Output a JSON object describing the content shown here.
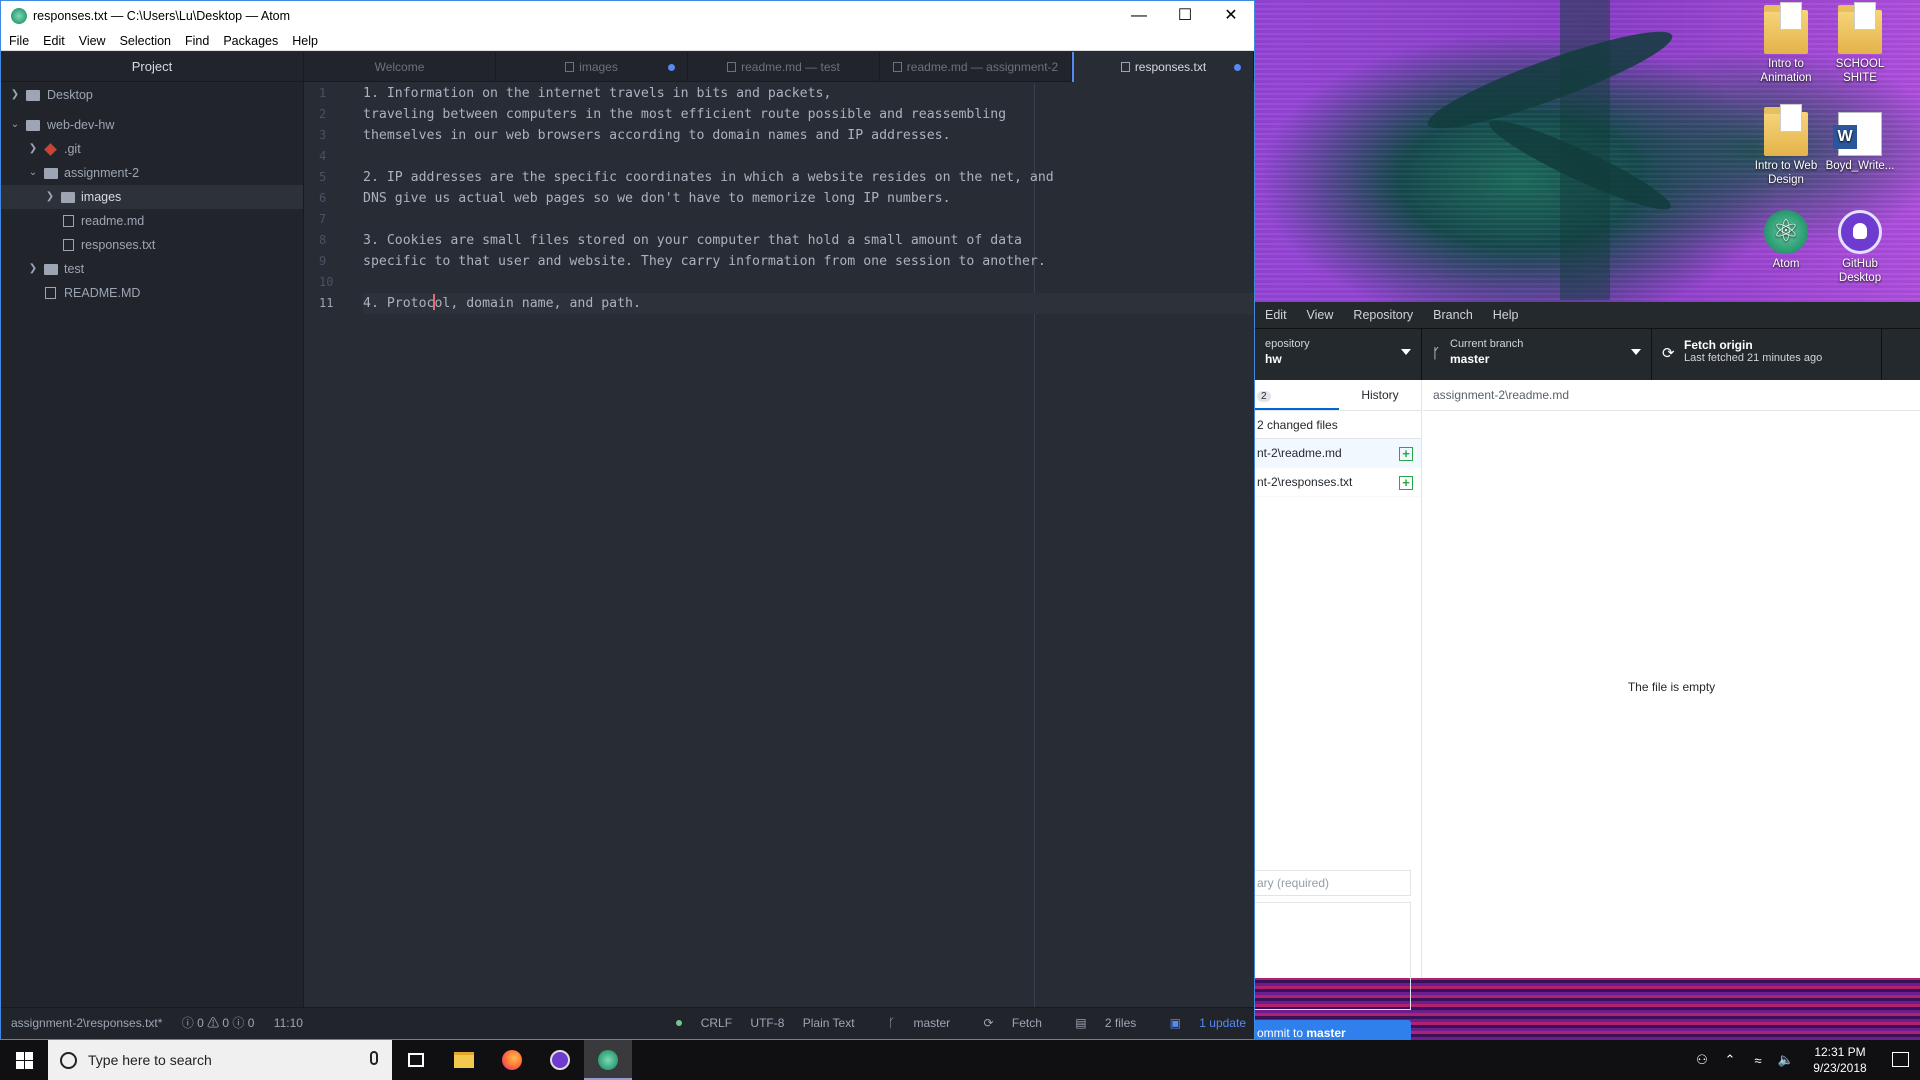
{
  "atom": {
    "window_title": "responses.txt — C:\\Users\\Lu\\Desktop — Atom",
    "menu": [
      "File",
      "Edit",
      "View",
      "Selection",
      "Find",
      "Packages",
      "Help"
    ],
    "tree_view": {
      "header": "Project",
      "items": [
        {
          "label": "Desktop",
          "kind": "folder",
          "expanded": false,
          "depth": 0
        },
        {
          "label": "web-dev-hw",
          "kind": "folder",
          "expanded": true,
          "depth": 0
        },
        {
          "label": ".git",
          "kind": "git",
          "expanded": false,
          "depth": 1
        },
        {
          "label": "assignment-2",
          "kind": "folder",
          "expanded": true,
          "depth": 1
        },
        {
          "label": "images",
          "kind": "folder",
          "expanded": false,
          "depth": 2,
          "selected": true
        },
        {
          "label": "readme.md",
          "kind": "file",
          "depth": 2
        },
        {
          "label": "responses.txt",
          "kind": "file",
          "depth": 2
        },
        {
          "label": "test",
          "kind": "folder",
          "expanded": false,
          "depth": 1
        },
        {
          "label": "README.MD",
          "kind": "file",
          "depth": 1
        }
      ]
    },
    "tabs": [
      {
        "label": "Welcome",
        "modified": false,
        "active": false
      },
      {
        "label": "images",
        "modified": true,
        "active": false
      },
      {
        "label": "readme.md — test",
        "modified": false,
        "active": false
      },
      {
        "label": "readme.md — assignment-2",
        "modified": false,
        "active": false
      },
      {
        "label": "responses.txt",
        "modified": true,
        "active": true
      }
    ],
    "editor": {
      "lines": [
        "1. Information on the internet travels in bits and packets,",
        "traveling between computers in the most efficient route possible and reassembling",
        "themselves in our web browsers according to domain names and IP addresses.",
        "",
        "2. IP addresses are the specific coordinates in which a website resides on the net, and",
        "DNS give us actual web pages so we don't have to memorize long IP numbers.",
        "",
        "3. Cookies are small files stored on your computer that hold a small amount of data",
        "specific to that user and website. They carry information from one session to another.",
        "",
        "4. Protocol, domain name, and path."
      ],
      "cursor_line": 11,
      "cursor_col": 10
    },
    "status_bar": {
      "file_path": "assignment-2\\responses.txt*",
      "diagnostics": "ⓘ 0 ⚠ 0 ⓘ 0",
      "cursor_pos": "11:10",
      "line_ending": "CRLF",
      "encoding": "UTF-8",
      "grammar": "Plain Text",
      "branch": "master",
      "fetch": "Fetch",
      "files": "2 files",
      "updates": "1 update"
    }
  },
  "github_desktop": {
    "menu": [
      "Edit",
      "View",
      "Repository",
      "Branch",
      "Help"
    ],
    "repo_label": "epository",
    "repo_name": "hw",
    "branch_label": "Current branch",
    "branch_name": "master",
    "fetch_label": "Fetch origin",
    "fetch_sub": "Last fetched 21 minutes ago",
    "tab_changes_count": "2",
    "tab_history": "History",
    "changed_files_header": "2 changed files",
    "changed_files": [
      "nt-2\\readme.md",
      "nt-2\\responses.txt"
    ],
    "diff_path": "assignment-2\\readme.md",
    "empty_message": "The file is empty",
    "summary_placeholder": "ary (required)",
    "commit_prefix": "ommit to ",
    "commit_branch": "master"
  },
  "desktop_icons": [
    {
      "label": "Intro to Animation",
      "kind": "folder"
    },
    {
      "label": "SCHOOL SHITE",
      "kind": "folder"
    },
    {
      "label": "Intro to Web Design",
      "kind": "folder"
    },
    {
      "label": "Boyd_Write...",
      "kind": "word"
    },
    {
      "label": "Atom",
      "kind": "atom"
    },
    {
      "label": "GitHub Desktop",
      "kind": "github"
    }
  ],
  "taskbar": {
    "search_placeholder": "Type here to search",
    "apps": [
      "task-view",
      "file-explorer",
      "firefox",
      "github-desktop",
      "atom"
    ],
    "time": "12:31 PM",
    "date": "9/23/2018"
  },
  "colors": {
    "accent": "#568af2",
    "editor_bg": "#282c34",
    "panel_bg": "#21252b",
    "commit_button": "#2f80ed",
    "added_green": "#28a745"
  }
}
